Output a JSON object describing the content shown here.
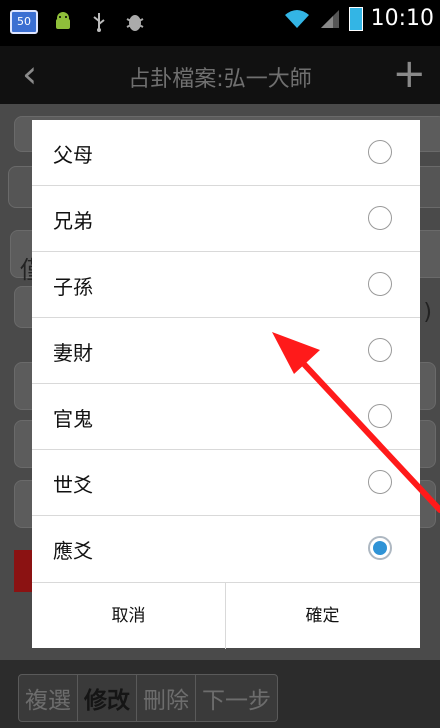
{
  "status_bar": {
    "notification_badge": "50",
    "time": "10:10",
    "icons": [
      "notification-50-icon",
      "android-icon",
      "usb-icon",
      "debug-icon",
      "wifi-icon",
      "signal-icon",
      "battery-icon"
    ]
  },
  "app_bar": {
    "title": "占卦檔案:弘一大師",
    "back_icon": "back-icon",
    "add_icon": "add-icon"
  },
  "background": {
    "partial_char": "僅",
    "partial_paren": ")"
  },
  "dialog": {
    "options": [
      {
        "label": "父母",
        "checked": false
      },
      {
        "label": "兄弟",
        "checked": false
      },
      {
        "label": "子孫",
        "checked": false
      },
      {
        "label": "妻財",
        "checked": false
      },
      {
        "label": "官鬼",
        "checked": false
      },
      {
        "label": "世爻",
        "checked": false
      },
      {
        "label": "應爻",
        "checked": true
      }
    ],
    "cancel_label": "取消",
    "ok_label": "確定"
  },
  "toolbar": {
    "buttons": [
      {
        "label": "複選"
      },
      {
        "label": "修改"
      },
      {
        "label": "刪除"
      },
      {
        "label": "下一步"
      }
    ]
  },
  "colors": {
    "accent": "#2f93d6",
    "annotation_arrow": "#ff1a1a"
  }
}
